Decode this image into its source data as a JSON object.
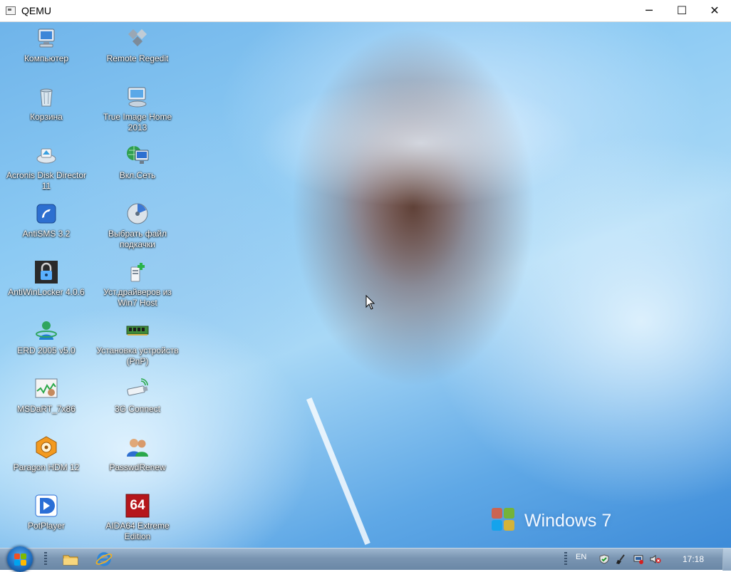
{
  "window": {
    "title": "QEMU",
    "minimize_glyph": "─",
    "maximize_glyph": "☐",
    "close_glyph": "✕"
  },
  "desktop": {
    "watermark": "Windows 7",
    "icons": [
      {
        "label": "Компьютер",
        "icon": "computer-icon"
      },
      {
        "label": "Remote Regedit",
        "icon": "regedit-icon"
      },
      {
        "label": "Корзина",
        "icon": "recycle-bin-icon"
      },
      {
        "label": "True Image Home 2013",
        "icon": "true-image-icon"
      },
      {
        "label": "Acronis Disk Director 11",
        "icon": "disk-director-icon"
      },
      {
        "label": "Вкл.Сеть",
        "icon": "network-icon"
      },
      {
        "label": "AntiSMS 3.2",
        "icon": "antisms-icon"
      },
      {
        "label": "Выбрать файл подкачки",
        "icon": "pagefile-icon"
      },
      {
        "label": "AntiWinLocker 4.0.6",
        "icon": "padlock-icon"
      },
      {
        "label": "Уст.драйверов из Win7 Host",
        "icon": "driver-install-icon"
      },
      {
        "label": "ERD 2005 v5.0",
        "icon": "erd-icon"
      },
      {
        "label": "Установка устройств (PnP)",
        "icon": "memory-module-icon"
      },
      {
        "label": "MSDaRT_7x86",
        "icon": "msdart-icon"
      },
      {
        "label": "3G Connect",
        "icon": "usb-modem-icon"
      },
      {
        "label": "Paragon HDM 12",
        "icon": "paragon-icon"
      },
      {
        "label": "PasswdRenew",
        "icon": "users-icon"
      },
      {
        "label": "PotPlayer",
        "icon": "potplayer-icon"
      },
      {
        "label": "AIDA64 Extreme Edition",
        "icon": "aida64-icon"
      }
    ],
    "aida_badge": "64"
  },
  "taskbar": {
    "pinned": [
      "explorer-folder-icon",
      "internet-explorer-icon"
    ],
    "language": "EN",
    "time": "17:18",
    "tray": [
      "shield-check-icon",
      "broom-icon",
      "network-tray-icon",
      "volume-muted-icon"
    ]
  },
  "colors": {
    "taskbar": "#7a95b2",
    "start_orb": "#1f6fc1",
    "desktop_sky": "#8ccaf3"
  }
}
